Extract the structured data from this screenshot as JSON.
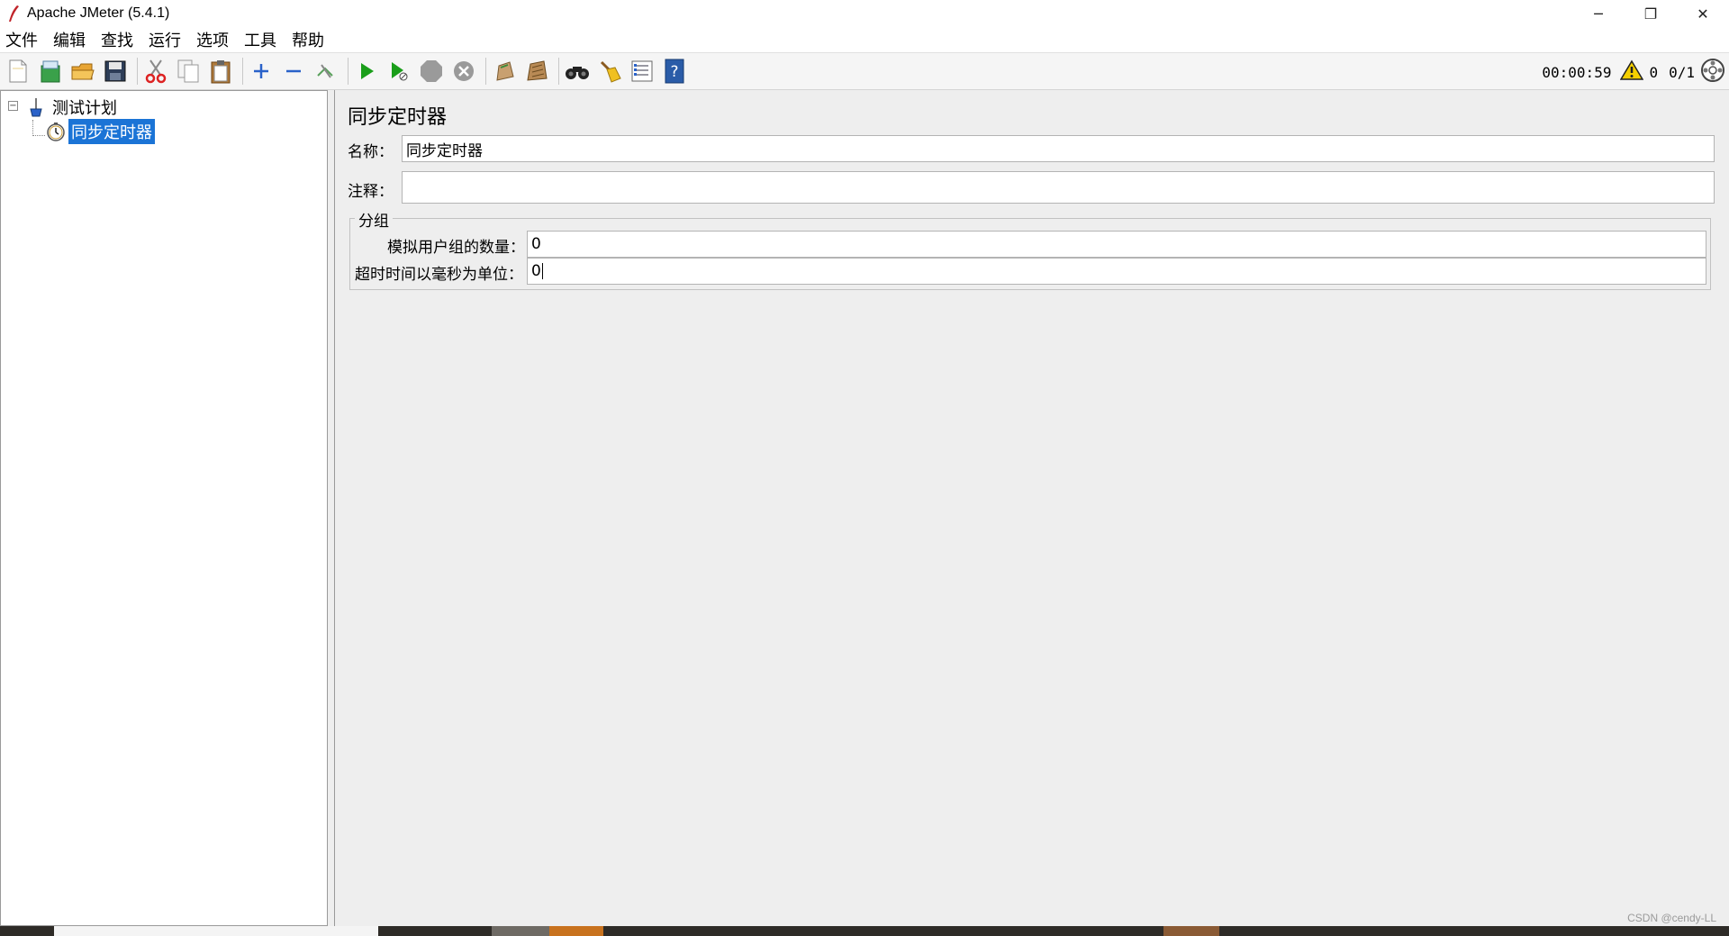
{
  "window": {
    "title": "Apache JMeter (5.4.1)",
    "controls": {
      "minimize": "─",
      "restore": "❐",
      "close": "✕"
    }
  },
  "menu": {
    "items": [
      "文件",
      "编辑",
      "查找",
      "运行",
      "选项",
      "工具",
      "帮助"
    ]
  },
  "toolbar": {
    "buttons": [
      "new-icon",
      "templates-icon",
      "open-icon",
      "save-icon",
      "cut-icon",
      "copy-icon",
      "paste-icon",
      "expand-icon",
      "collapse-icon",
      "toggle-icon",
      "start-icon",
      "start-no-pause-icon",
      "stop-icon",
      "shutdown-icon",
      "remote-clear-icon",
      "clear-all-icon",
      "search-icon",
      "reset-search-icon",
      "function-helper-icon",
      "help-icon"
    ],
    "elapsed_time": "00:00:59",
    "warning_count": "0",
    "threads": "0/1"
  },
  "tree": {
    "root_label": "测试计划",
    "child_label": "同步定时器"
  },
  "editor": {
    "title": "同步定时器",
    "name_label": "名称：",
    "name_value": "同步定时器",
    "comment_label": "注释：",
    "comment_value": "",
    "group_title": "分组",
    "users_label": "模拟用户组的数量：",
    "users_value": "0",
    "timeout_label": "超时时间以毫秒为单位：",
    "timeout_value": "0"
  },
  "watermark": "CSDN @cendy-LL",
  "colors": {
    "selection": "#1b74d6",
    "start_green": "#1a9e1a",
    "panel_bg": "#eeeeee"
  }
}
